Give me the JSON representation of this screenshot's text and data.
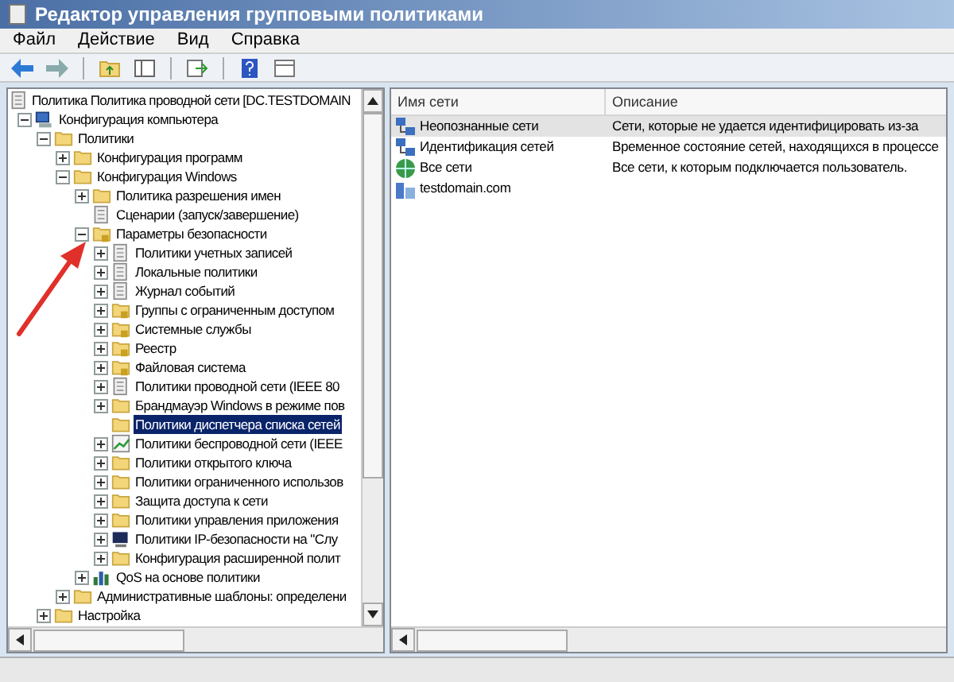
{
  "window": {
    "title": "Редактор управления групповыми политиками"
  },
  "menu": [
    "Файл",
    "Действие",
    "Вид",
    "Справка"
  ],
  "tree": {
    "root": "Политика Политика проводной сети [DC.TESTDOMAIN",
    "items": [
      {
        "label": "Конфигурация компьютера",
        "kind": "computer",
        "has_toggle": true,
        "expanded": true,
        "selected": false,
        "children": [
          {
            "label": "Политики",
            "kind": "folder",
            "has_toggle": true,
            "expanded": true,
            "selected": false,
            "children": [
              {
                "label": "Конфигурация программ",
                "kind": "folder",
                "has_toggle": true,
                "expanded": false,
                "selected": false
              },
              {
                "label": "Конфигурация Windows",
                "kind": "folder",
                "has_toggle": true,
                "expanded": true,
                "selected": false,
                "children": [
                  {
                    "label": "Политика разрешения имен",
                    "kind": "folder",
                    "has_toggle": true,
                    "expanded": false,
                    "selected": false
                  },
                  {
                    "label": "Сценарии (запуск/завершение)",
                    "kind": "document",
                    "has_toggle": false,
                    "expanded": false,
                    "selected": false
                  },
                  {
                    "label": "Параметры безопасности",
                    "kind": "secure-folder",
                    "has_toggle": true,
                    "expanded": true,
                    "selected": false,
                    "children": [
                      {
                        "label": "Политики учетных записей",
                        "kind": "document",
                        "has_toggle": true,
                        "expanded": false,
                        "selected": false
                      },
                      {
                        "label": "Локальные политики",
                        "kind": "document",
                        "has_toggle": true,
                        "expanded": false,
                        "selected": false
                      },
                      {
                        "label": "Журнал событий",
                        "kind": "document",
                        "has_toggle": true,
                        "expanded": false,
                        "selected": false
                      },
                      {
                        "label": "Группы с ограниченным доступом",
                        "kind": "secure-folder",
                        "has_toggle": true,
                        "expanded": false,
                        "selected": false
                      },
                      {
                        "label": "Системные службы",
                        "kind": "secure-folder",
                        "has_toggle": true,
                        "expanded": false,
                        "selected": false
                      },
                      {
                        "label": "Реестр",
                        "kind": "secure-folder",
                        "has_toggle": true,
                        "expanded": false,
                        "selected": false
                      },
                      {
                        "label": "Файловая система",
                        "kind": "secure-folder",
                        "has_toggle": true,
                        "expanded": false,
                        "selected": false
                      },
                      {
                        "label": "Политики проводной сети (IEEE 80",
                        "kind": "document",
                        "has_toggle": true,
                        "expanded": false,
                        "selected": false
                      },
                      {
                        "label": "Брандмауэр Windows в режиме пов",
                        "kind": "folder",
                        "has_toggle": true,
                        "expanded": false,
                        "selected": false
                      },
                      {
                        "label": "Политики диспетчера списка сетей",
                        "kind": "folder",
                        "has_toggle": false,
                        "expanded": false,
                        "selected": true
                      },
                      {
                        "label": "Политики беспроводной сети (IEEE",
                        "kind": "chart",
                        "has_toggle": true,
                        "expanded": false,
                        "selected": false
                      },
                      {
                        "label": "Политики открытого ключа",
                        "kind": "folder",
                        "has_toggle": true,
                        "expanded": false,
                        "selected": false
                      },
                      {
                        "label": "Политики ограниченного использов",
                        "kind": "folder",
                        "has_toggle": true,
                        "expanded": false,
                        "selected": false
                      },
                      {
                        "label": "Защита доступа к сети",
                        "kind": "folder",
                        "has_toggle": true,
                        "expanded": false,
                        "selected": false
                      },
                      {
                        "label": "Политики управления приложения",
                        "kind": "folder",
                        "has_toggle": true,
                        "expanded": false,
                        "selected": false
                      },
                      {
                        "label": "Политики IP-безопасности на \"Слу",
                        "kind": "monitor",
                        "has_toggle": true,
                        "expanded": false,
                        "selected": false
                      },
                      {
                        "label": "Конфигурация расширенной полит",
                        "kind": "folder",
                        "has_toggle": true,
                        "expanded": false,
                        "selected": false
                      }
                    ]
                  },
                  {
                    "label": "QoS на основе политики",
                    "kind": "bars",
                    "has_toggle": true,
                    "expanded": false,
                    "selected": false
                  }
                ]
              },
              {
                "label": "Административные шаблоны: определени",
                "kind": "folder",
                "has_toggle": true,
                "expanded": false,
                "selected": false
              }
            ]
          },
          {
            "label": "Настройка",
            "kind": "folder",
            "has_toggle": true,
            "expanded": false,
            "selected": false
          }
        ]
      }
    ]
  },
  "list": {
    "columns": [
      "Имя сети",
      "Описание"
    ],
    "rows": [
      {
        "name": "Неопознанные сети",
        "description": "Сети, которые не удается идентифицировать из-за",
        "kind": "network",
        "selected": true
      },
      {
        "name": "Идентификация сетей",
        "description": "Временное состояние сетей, находящихся в процессе",
        "kind": "network",
        "selected": false
      },
      {
        "name": "Все сети",
        "description": "Все сети, к которым подключается пользователь.",
        "kind": "globe",
        "selected": false
      },
      {
        "name": "testdomain.com",
        "description": "",
        "kind": "domain",
        "selected": false
      }
    ]
  }
}
